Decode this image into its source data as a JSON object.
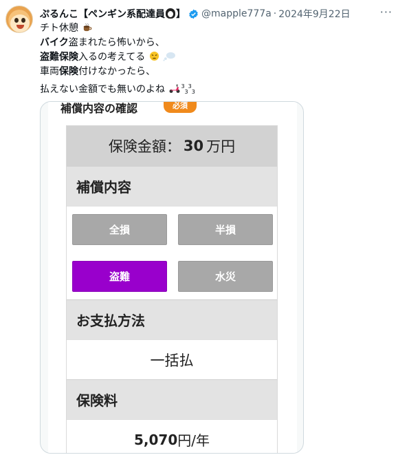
{
  "author": {
    "name": "ぷるんこ【ペンギン系配達員",
    "name_suffix": "】",
    "handle": "@mapple777a",
    "separator": "·",
    "date": "2024年9月22日",
    "more_label": "···"
  },
  "tweet": {
    "line1": {
      "text": "チト休憩",
      "emoji": "coffee-icon"
    },
    "line2": {
      "bold": "バイク",
      "text": "盗まれたら怖いから、"
    },
    "line3": {
      "bold": "盗難保険",
      "text": "入るの考えてる",
      "emojis": [
        "weary-face-icon",
        "thought-bubble-icon"
      ]
    },
    "line4": {
      "text_a": "車両",
      "bold": "保険",
      "text_b": "付けなかったら、"
    },
    "line5": {
      "text": "払えない金額でも無いのよね",
      "emoji": "scooter-icon",
      "tail_sup": "3",
      "tail_sub": "3",
      "tail_sup2": "3",
      "tail_sub2": "3"
    }
  },
  "screenshot": {
    "title": "補償内容の確認",
    "required_badge": "必須",
    "amount_label": "保険金額：",
    "amount_value": "30",
    "amount_unit": "万円",
    "coverage_heading": "補償内容",
    "coverage_options": [
      {
        "label": "全損",
        "selected": false
      },
      {
        "label": "半損",
        "selected": false
      },
      {
        "label": "盗難",
        "selected": true
      },
      {
        "label": "水災",
        "selected": false
      }
    ],
    "payment_heading": "お支払方法",
    "payment_value": "一括払",
    "premium_heading": "保険料",
    "premium_value": "5,070",
    "premium_unit": "円/年"
  },
  "colors": {
    "selected_option": "#9900cc",
    "unselected_option": "#a8a8a8",
    "required_badge": "#f08a1c",
    "verified": "#1d9bf0"
  }
}
